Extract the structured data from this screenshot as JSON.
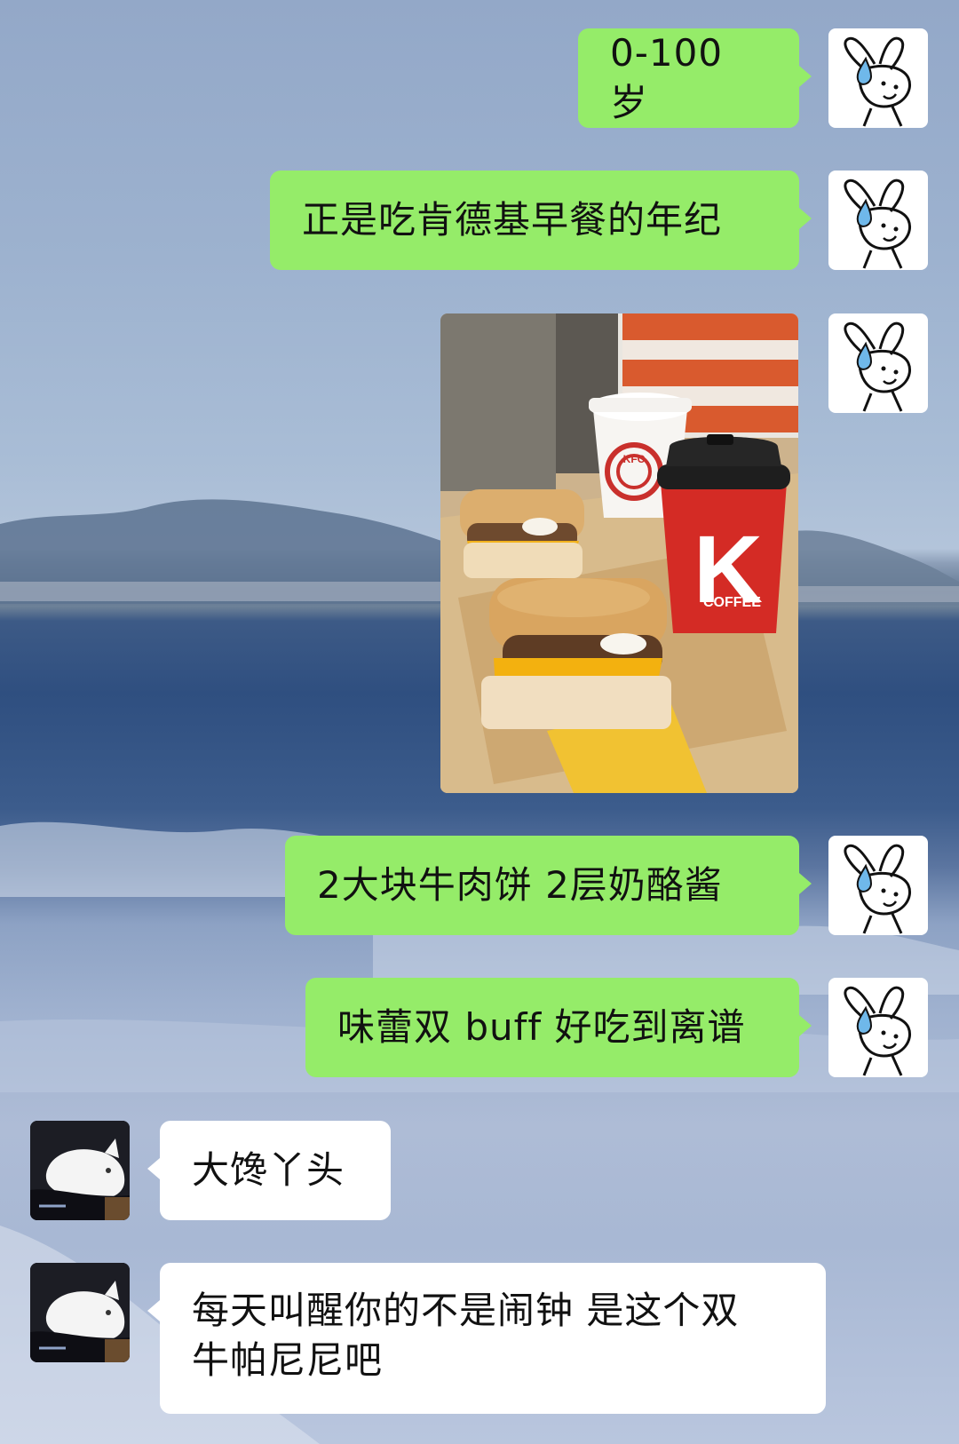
{
  "chat": {
    "messages": [
      {
        "side": "me",
        "text": "0-100 岁"
      },
      {
        "side": "me",
        "text": "正是吃肯德基早餐的年纪"
      },
      {
        "side": "me",
        "type": "image",
        "image_desc": "kfc-breakfast-photo"
      },
      {
        "side": "me",
        "text": "2大块牛肉饼 2层奶酪酱"
      },
      {
        "side": "me",
        "text": "味蕾双 buff 好吃到离谱"
      },
      {
        "side": "other",
        "text": "大馋丫头"
      },
      {
        "side": "other",
        "text_line1": "每天叫醒你的不是闹钟 是这个双",
        "text_line2": "牛帕尼尼吧"
      }
    ]
  },
  "photo": {
    "cup_small_brand": "KFC",
    "cup_large_letter": "K",
    "cup_large_text": "COFFEE"
  },
  "colors": {
    "my_bubble": "#95ec69",
    "other_bubble": "#ffffff"
  },
  "avatars": {
    "me": "bunny-sweat-avatar",
    "other": "white-cat-avatar"
  }
}
